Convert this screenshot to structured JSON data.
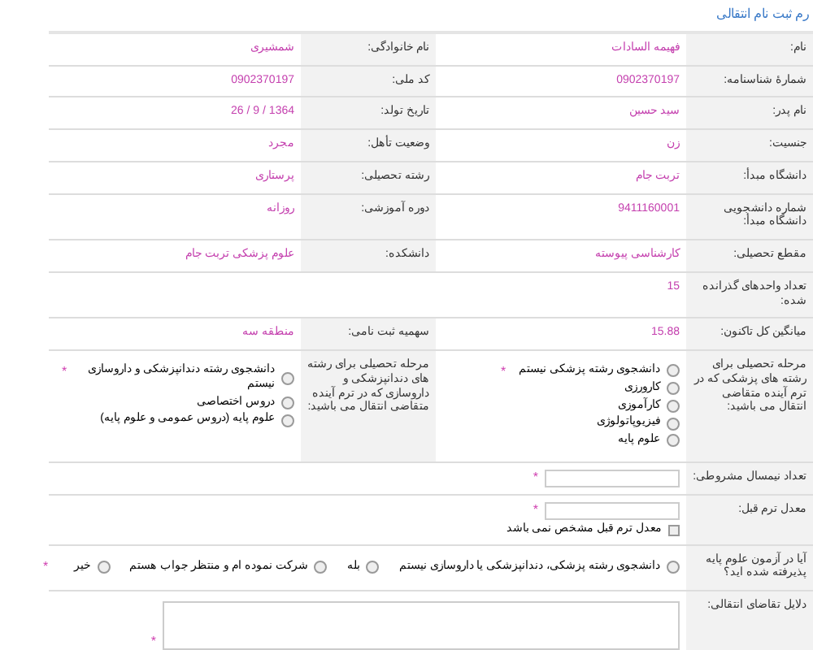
{
  "title": "رم ثبت نام انتقالی",
  "rows": [
    {
      "kind": "pair",
      "fields": [
        {
          "label": "نام:",
          "value": "فهیمه السادات"
        },
        {
          "label": "نام خانوادگی:",
          "value": "شمشیری"
        }
      ]
    },
    {
      "kind": "pair",
      "fields": [
        {
          "label": "شمارهٔ شناسنامه:",
          "value": "0902370197"
        },
        {
          "label": "کد ملی:",
          "value": "0902370197"
        }
      ]
    },
    {
      "kind": "pair",
      "fields": [
        {
          "label": "نام پدر:",
          "value": "سید حسین"
        },
        {
          "label": "تاریخ تولد:",
          "value": "1364 / 9 / 26"
        }
      ]
    },
    {
      "kind": "pair",
      "fields": [
        {
          "label": "جنسیت:",
          "value": "زن"
        },
        {
          "label": "وضعیت تأهل:",
          "value": "مجرد"
        }
      ]
    },
    {
      "kind": "pair",
      "fields": [
        {
          "label": "دانشگاه مبدأ:",
          "value": "تربت جام"
        },
        {
          "label": "رشته تحصیلی:",
          "value": "پرستاری"
        }
      ]
    },
    {
      "kind": "pair",
      "fields": [
        {
          "label": "شماره دانشجویی دانشگاه مبدأ:",
          "value": "9411160001"
        },
        {
          "label": "دوره آموزشی:",
          "value": "روزانه"
        }
      ]
    },
    {
      "kind": "pair",
      "fields": [
        {
          "label": "مقطع تحصیلی:",
          "value": "کارشناسی پیوسته"
        },
        {
          "label": "دانشکده:",
          "value": "علوم پزشکی تربت جام"
        }
      ]
    },
    {
      "kind": "pair",
      "fields": [
        {
          "label": "تعداد واحدهای گذرانده شده:",
          "value": "15"
        }
      ]
    },
    {
      "kind": "pair",
      "fields": [
        {
          "label": "میانگین کل تاکنون:",
          "value": "15.88"
        },
        {
          "label": "سهمیه ثبت نامی:",
          "value": "منطقه سه"
        }
      ]
    },
    {
      "kind": "radios",
      "groups": [
        {
          "label": "مرحله تحصیلی برای رشته های پزشکی که در ترم آینده متقاضی انتقال می باشید:",
          "required": "*",
          "options": [
            {
              "text": "دانشجوی رشته پزشکی نیستم",
              "selected": false
            },
            {
              "text": "کارورزی",
              "selected": false
            },
            {
              "text": "کارآموزی",
              "selected": false
            },
            {
              "text": "فیزیوپاتولوژی",
              "selected": false
            },
            {
              "text": "علوم پایه",
              "selected": false
            }
          ]
        },
        {
          "label": "مرحله تحصیلی برای رشته های دندانپزشکی و داروسازی که در ترم آینده متقاضی انتقال می باشید:",
          "required": "*",
          "options": [
            {
              "text": "دانشجوی رشته دندانپزشکی و داروسازی نیستم",
              "selected": false
            },
            {
              "text": "دروس اختصاصی",
              "selected": false
            },
            {
              "text": "علوم پایه (دروس عمومی و علوم پایه)",
              "selected": false
            }
          ]
        }
      ]
    },
    {
      "kind": "input",
      "label": "تعداد نیمسال مشروطی:",
      "required": "*"
    },
    {
      "kind": "input",
      "label": "معدل ترم قبل:",
      "required": "*",
      "checkbox": {
        "text": "معدل ترم قبل مشخص نمی باشد",
        "checked": false
      }
    },
    {
      "kind": "inline_radios",
      "label": "آیا در آزمون علوم پایه پذیرفته شده اید؟",
      "required": "*",
      "options": [
        {
          "text": "دانشجوی رشته پزشکی، دندانپزشکی یا داروسازی نیستم",
          "selected": false
        },
        {
          "text": "بله",
          "selected": false
        },
        {
          "text": "شرکت نموده ام و منتظر جواب هستم",
          "selected": false
        },
        {
          "text": "خیر",
          "selected": false
        }
      ]
    },
    {
      "kind": "textarea",
      "label": "دلایل تقاضای انتقالی:",
      "required": "*"
    }
  ]
}
